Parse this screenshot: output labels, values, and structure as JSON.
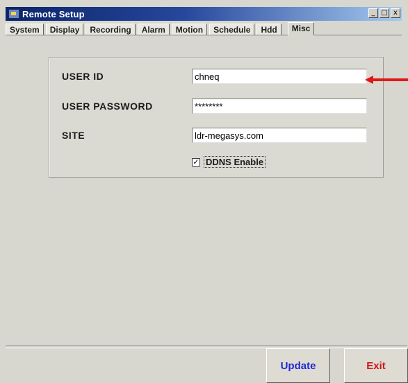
{
  "window": {
    "title": "Remote Setup",
    "controls": [
      "_",
      "□",
      "x"
    ]
  },
  "tabs": [
    {
      "label": "System",
      "active": false
    },
    {
      "label": "Display",
      "active": false
    },
    {
      "label": "Recording",
      "active": false
    },
    {
      "label": "Alarm",
      "active": false
    },
    {
      "label": "Motion",
      "active": false
    },
    {
      "label": "Schedule",
      "active": false
    },
    {
      "label": "Hdd",
      "active": false
    },
    {
      "label": "Misc",
      "active": true
    }
  ],
  "form": {
    "user_id_label": "USER ID",
    "user_id_value": "chneq",
    "password_label": "USER PASSWORD",
    "password_value": "********",
    "site_label": "SITE",
    "site_value": "ldr-megasys.com",
    "ddns_label": "DDNS Enable",
    "ddns_checked": "✓"
  },
  "buttons": {
    "update_label": "Update",
    "exit_label": "Exit"
  },
  "colors": {
    "update_text": "#1d2ad2",
    "exit_text": "#d01717",
    "arrow": "#e01818"
  },
  "icons": {
    "app": "app-icon",
    "annotation": "red-arrow-icon"
  }
}
